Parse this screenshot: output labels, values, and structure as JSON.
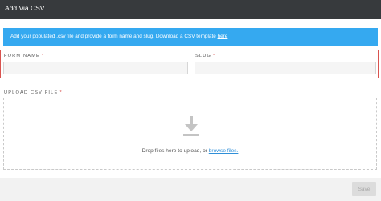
{
  "header": {
    "title": "Add Via CSV"
  },
  "banner": {
    "text": "Add your populated .csv file and provide a form name and slug. Download a CSV template ",
    "link": "here"
  },
  "fields": {
    "form_name": {
      "label": "FORM NAME",
      "required_mark": "*",
      "value": ""
    },
    "slug": {
      "label": "SLUG",
      "required_mark": "*",
      "value": ""
    }
  },
  "upload": {
    "label": "UPLOAD CSV FILE",
    "required_mark": "*",
    "drop_text": "Drop files here to upload, or ",
    "browse_link": "browse files."
  },
  "footer": {
    "save_label": "Save"
  },
  "colors": {
    "header_bg": "#373a3d",
    "banner_bg": "#35a9f0",
    "error_border": "#d9534f",
    "link": "#2f8fd8"
  },
  "icons": {
    "upload": "download-arrow-icon"
  }
}
